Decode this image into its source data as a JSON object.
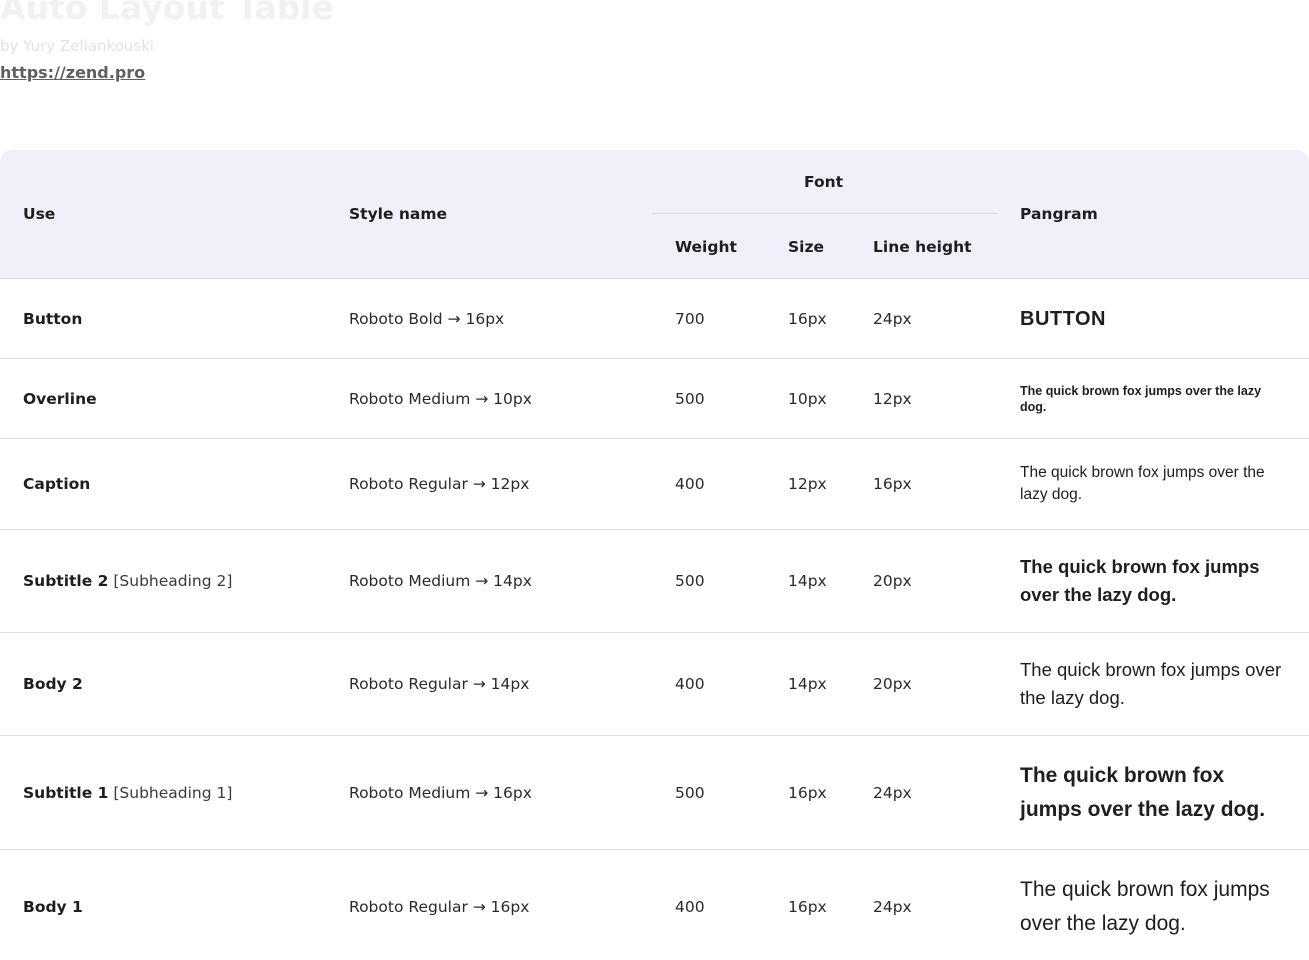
{
  "doc": {
    "title": "Auto Layout Table",
    "author": "by Yury Zeliankouski",
    "link": "https://zend.pro"
  },
  "table": {
    "headers": {
      "use": "Use",
      "style_name": "Style name",
      "font_group": "Font",
      "weight": "Weight",
      "size": "Size",
      "line_height": "Line height",
      "pangram": "Pangram"
    },
    "rows": [
      {
        "use": "Button",
        "use_note": "",
        "style": "Roboto Bold → 16px",
        "weight": "700",
        "size": "16px",
        "line_height": "24px",
        "pangram": "BUTTON"
      },
      {
        "use": "Overline",
        "use_note": "",
        "style": "Roboto Medium → 10px",
        "weight": "500",
        "size": "10px",
        "line_height": "12px",
        "pangram": "The quick brown fox jumps over the lazy dog."
      },
      {
        "use": "Caption",
        "use_note": "",
        "style": "Roboto Regular → 12px",
        "weight": "400",
        "size": "12px",
        "line_height": "16px",
        "pangram": "The quick brown fox jumps over the lazy dog."
      },
      {
        "use": "Subtitle 2",
        "use_note": "[Subheading 2]",
        "style": "Roboto Medium → 14px",
        "weight": "500",
        "size": "14px",
        "line_height": "20px",
        "pangram": "The quick brown fox jumps over the lazy dog."
      },
      {
        "use": "Body 2",
        "use_note": "",
        "style": "Roboto Regular → 14px",
        "weight": "400",
        "size": "14px",
        "line_height": "20px",
        "pangram": "The quick brown fox jumps over the lazy dog."
      },
      {
        "use": "Subtitle 1",
        "use_note": "[Subheading 1]",
        "style": "Roboto Medium → 16px",
        "weight": "500",
        "size": "16px",
        "line_height": "24px",
        "pangram": "The quick brown fox jumps over the lazy dog."
      },
      {
        "use": "Body 1",
        "use_note": "",
        "style": "Roboto Regular → 16px",
        "weight": "400",
        "size": "16px",
        "line_height": "24px",
        "pangram": "The quick brown fox jumps over the lazy dog."
      }
    ]
  }
}
